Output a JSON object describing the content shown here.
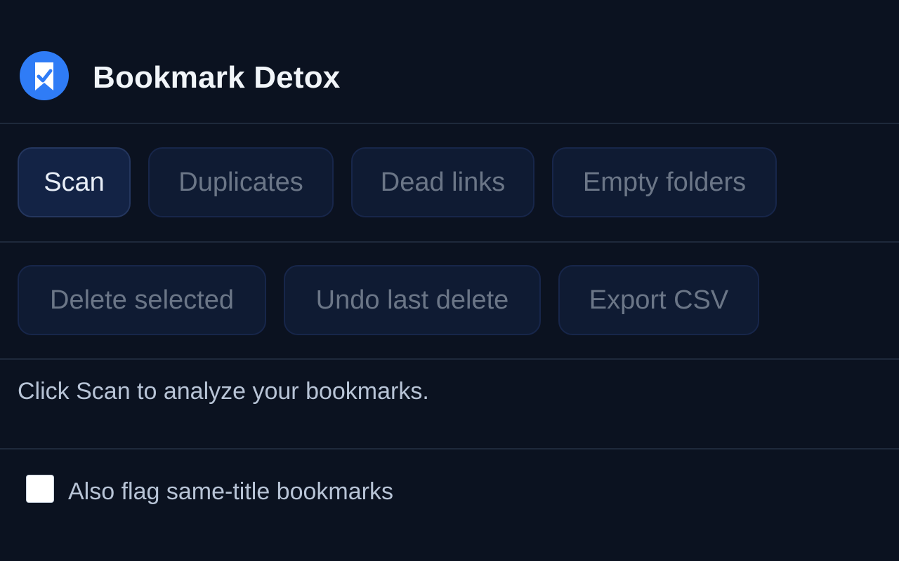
{
  "app": {
    "title": "Bookmark Detox",
    "logo_icon": "bookmark-check-icon",
    "brand_color": "#2f7cf6"
  },
  "tabs": [
    {
      "label": "Scan",
      "active": true
    },
    {
      "label": "Duplicates",
      "active": false
    },
    {
      "label": "Dead links",
      "active": false
    },
    {
      "label": "Empty folders",
      "active": false
    }
  ],
  "actions": [
    {
      "label": "Delete selected",
      "enabled": false
    },
    {
      "label": "Undo last delete",
      "enabled": false
    },
    {
      "label": "Export CSV",
      "enabled": false
    }
  ],
  "status": {
    "message": "Click Scan to analyze your bookmarks."
  },
  "options": {
    "same_title": {
      "label": "Also flag same-title bookmarks",
      "checked": false
    }
  }
}
